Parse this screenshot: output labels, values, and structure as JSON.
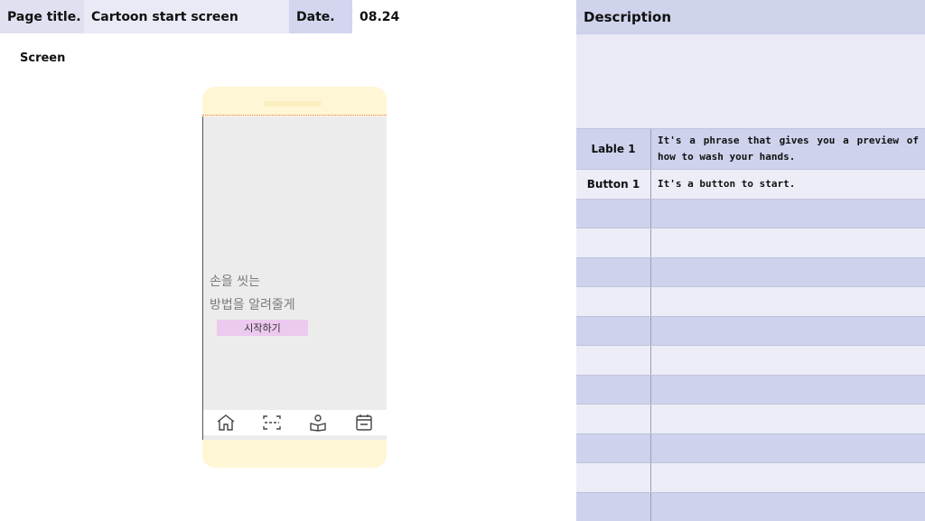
{
  "header": {
    "page_title_label": "Page title.",
    "page_title_value": "Cartoon start screen",
    "date_label": "Date.",
    "date_value": "08.24",
    "description_label": "Description"
  },
  "screen_label": "Screen",
  "phone": {
    "preview_line1": "손을 씻는",
    "preview_line2": "방법을 알려줄게",
    "start_button": "시작하기",
    "nav_icons": [
      "home-icon",
      "scan-icon",
      "reading-person-icon",
      "calendar-icon"
    ]
  },
  "description_table": {
    "rows": [
      {
        "name": "Lable 1",
        "desc": "It's a phrase that gives you a preview of how to wash your hands."
      },
      {
        "name": "Button 1",
        "desc": "It's a button to start."
      }
    ]
  },
  "colors": {
    "header_purple": "#cfd3ec",
    "phone_frame": "#fff6d6",
    "start_button": "#ecc9ee",
    "screen_gray": "#ececec"
  }
}
